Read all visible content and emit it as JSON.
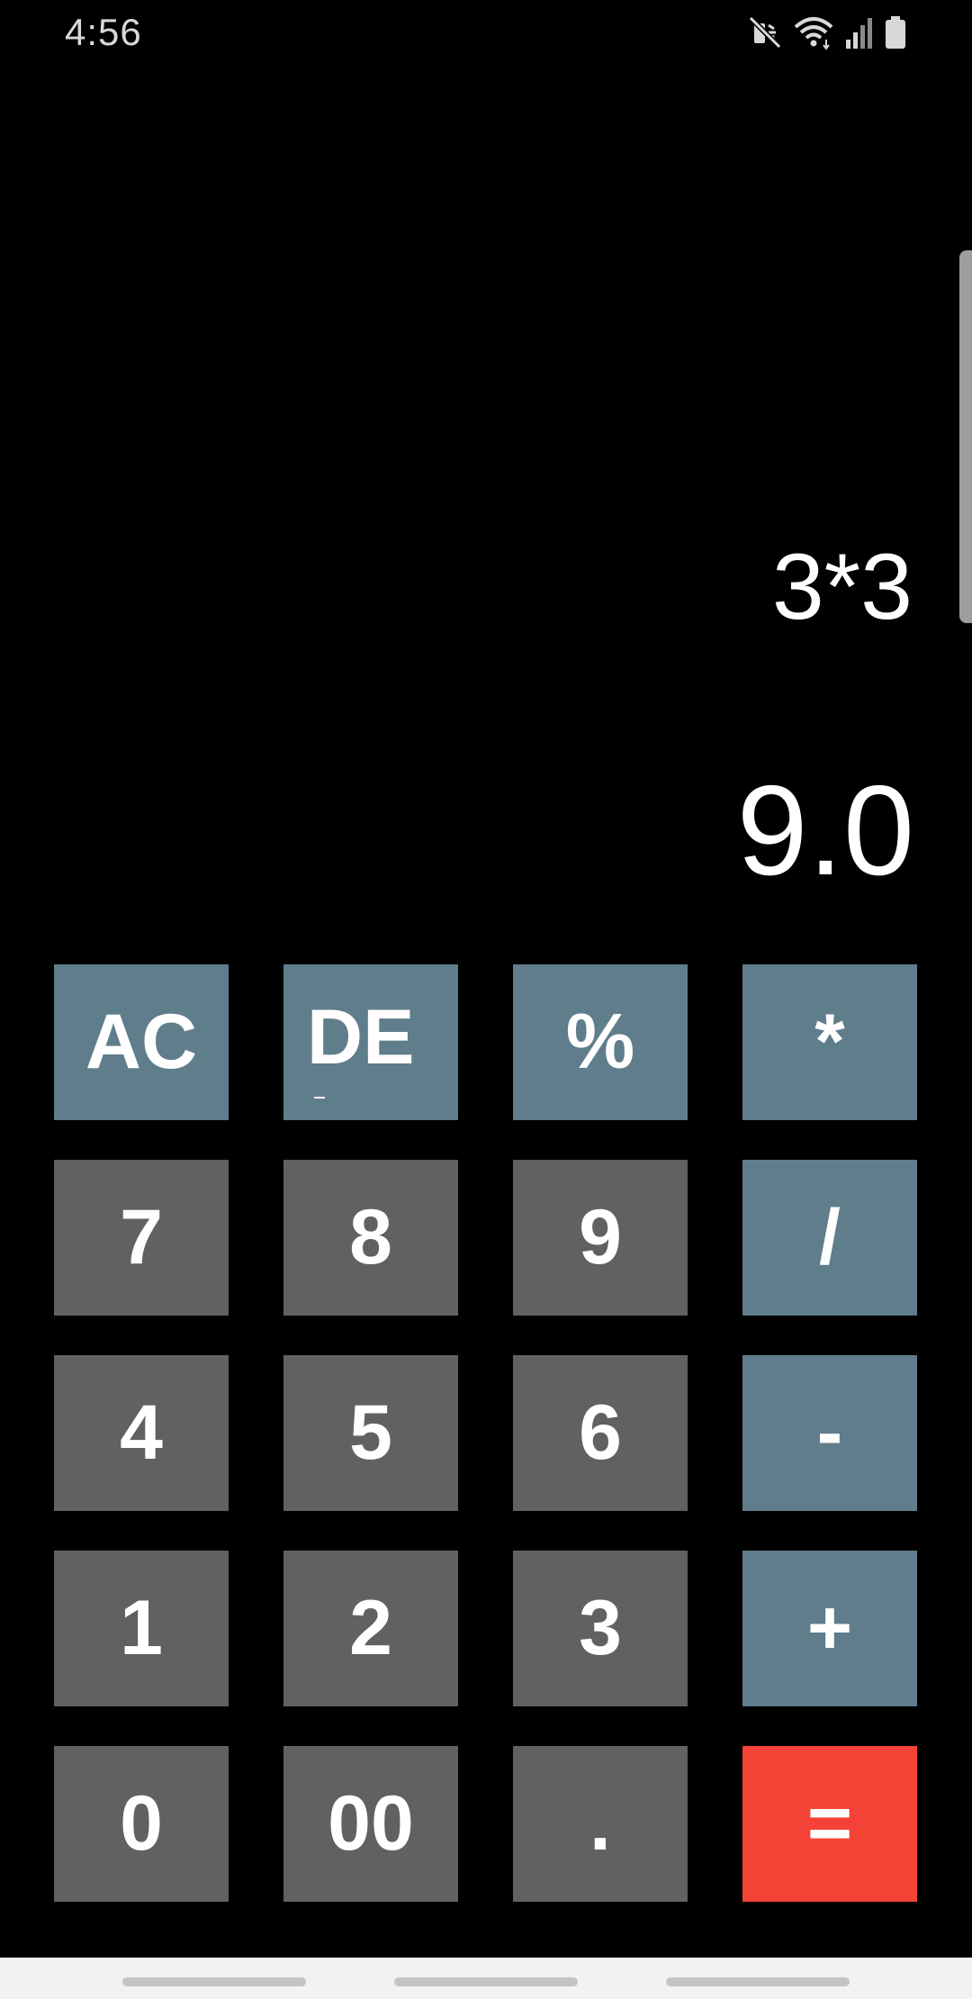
{
  "status_bar": {
    "time": "4:56",
    "icons": [
      "mute-icon",
      "wifi-icon",
      "signal-icon",
      "battery-icon"
    ]
  },
  "display": {
    "expression": "3*3",
    "result": "9.0"
  },
  "keypad": {
    "rows": [
      [
        {
          "label": "AC",
          "kind": "op",
          "name": "ac-button"
        },
        {
          "label": "DE",
          "kind": "op",
          "name": "delete-button"
        },
        {
          "label": "%",
          "kind": "op",
          "name": "percent-button"
        },
        {
          "label": "*",
          "kind": "op",
          "name": "multiply-button"
        }
      ],
      [
        {
          "label": "7",
          "kind": "num",
          "name": "digit-7-button"
        },
        {
          "label": "8",
          "kind": "num",
          "name": "digit-8-button"
        },
        {
          "label": "9",
          "kind": "num",
          "name": "digit-9-button"
        },
        {
          "label": "/",
          "kind": "op",
          "name": "divide-button"
        }
      ],
      [
        {
          "label": "4",
          "kind": "num",
          "name": "digit-4-button"
        },
        {
          "label": "5",
          "kind": "num",
          "name": "digit-5-button"
        },
        {
          "label": "6",
          "kind": "num",
          "name": "digit-6-button"
        },
        {
          "label": "-",
          "kind": "op",
          "name": "subtract-button"
        }
      ],
      [
        {
          "label": "1",
          "kind": "num",
          "name": "digit-1-button"
        },
        {
          "label": "2",
          "kind": "num",
          "name": "digit-2-button"
        },
        {
          "label": "3",
          "kind": "num",
          "name": "digit-3-button"
        },
        {
          "label": "+",
          "kind": "op",
          "name": "add-button"
        }
      ],
      [
        {
          "label": "0",
          "kind": "num",
          "name": "digit-0-button"
        },
        {
          "label": "00",
          "kind": "num",
          "name": "double-zero-button"
        },
        {
          "label": ".",
          "kind": "num",
          "name": "decimal-point-button"
        },
        {
          "label": "=",
          "kind": "eq",
          "name": "equals-button"
        }
      ]
    ]
  },
  "colors": {
    "background": "#000000",
    "number_key": "#616161",
    "operator_key": "#607d8b",
    "equals_key": "#f44336",
    "text": "#ffffff"
  }
}
